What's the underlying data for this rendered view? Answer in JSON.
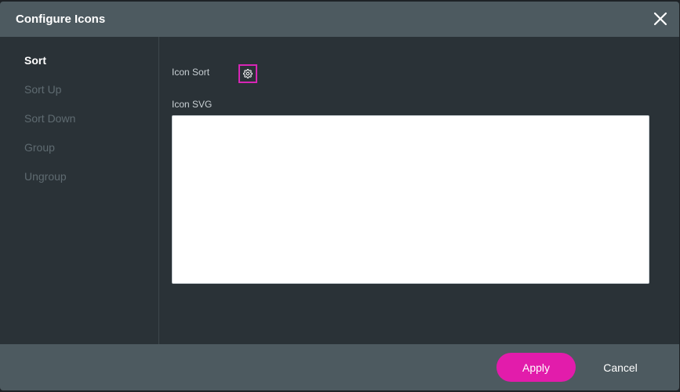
{
  "dialog": {
    "title": "Configure Icons",
    "close_icon": "close-icon"
  },
  "sidebar": {
    "items": [
      {
        "label": "Sort",
        "active": true
      },
      {
        "label": "Sort Up",
        "active": false
      },
      {
        "label": "Sort Down",
        "active": false
      },
      {
        "label": "Group",
        "active": false
      },
      {
        "label": "Ungroup",
        "active": false
      }
    ]
  },
  "content": {
    "icon_sort_label": "Icon Sort",
    "icon_sort_icon": "gear-icon",
    "icon_svg_label": "Icon SVG",
    "icon_svg_value": ""
  },
  "footer": {
    "apply_label": "Apply",
    "cancel_label": "Cancel"
  },
  "colors": {
    "accent": "#e21cab",
    "header_bg": "#4d5a60",
    "body_bg": "#2a3237"
  }
}
